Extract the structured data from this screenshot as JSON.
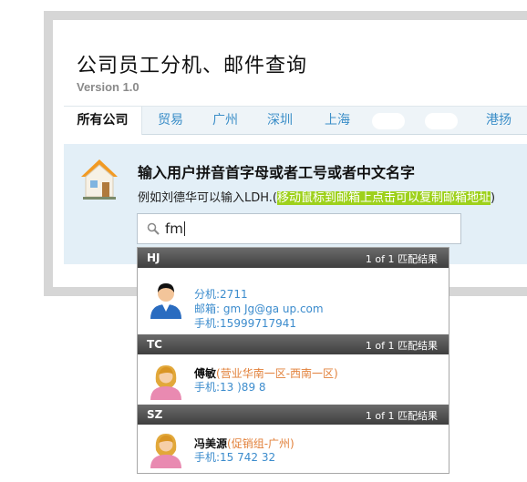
{
  "page": {
    "title": "公司员工分机、邮件查询",
    "version": "Version 1.0"
  },
  "tabs": [
    {
      "label": "所有公司",
      "active": true
    },
    {
      "label": "贸易"
    },
    {
      "label": "广州"
    },
    {
      "label": "深圳"
    },
    {
      "label": "上海"
    },
    {
      "label": ""
    },
    {
      "label": ""
    },
    {
      "label": "港扬"
    }
  ],
  "instructions": {
    "prompt": "输入用户拼音首字母或者工号或者中文名字",
    "example_prefix": "例如刘德华可以输入LDH.(",
    "example_highlight": "移动鼠标到邮箱上点击可以复制邮箱地址",
    "example_suffix": ")"
  },
  "search": {
    "value": "fm"
  },
  "results": [
    {
      "group": "HJ",
      "count": "1 of 1 匹配结果",
      "entries": [
        {
          "avatar": "male-avatar-icon",
          "name": "",
          "dept": "",
          "ext": "分机:2711",
          "email": "邮箱:   gm   Jg@ga                up.com",
          "phone": "手机:15999717941"
        }
      ]
    },
    {
      "group": "TC",
      "count": "1 of 1 匹配结果",
      "entries": [
        {
          "avatar": "female-avatar-icon",
          "name": "傅敏",
          "dept": "(营业华南一区-西南一区)",
          "phone": "手机:13    )89    8"
        }
      ]
    },
    {
      "group": "SZ",
      "count": "1 of 1 匹配结果",
      "entries": [
        {
          "avatar": "female-avatar-icon",
          "name": "冯美源",
          "dept": "(促销组-广州)",
          "phone": "手机:15       742     32"
        }
      ]
    }
  ],
  "colors": {
    "link_blue": "#3c8ccd",
    "dept_orange": "#e2813b",
    "highlight_green": "#9ed11c"
  }
}
